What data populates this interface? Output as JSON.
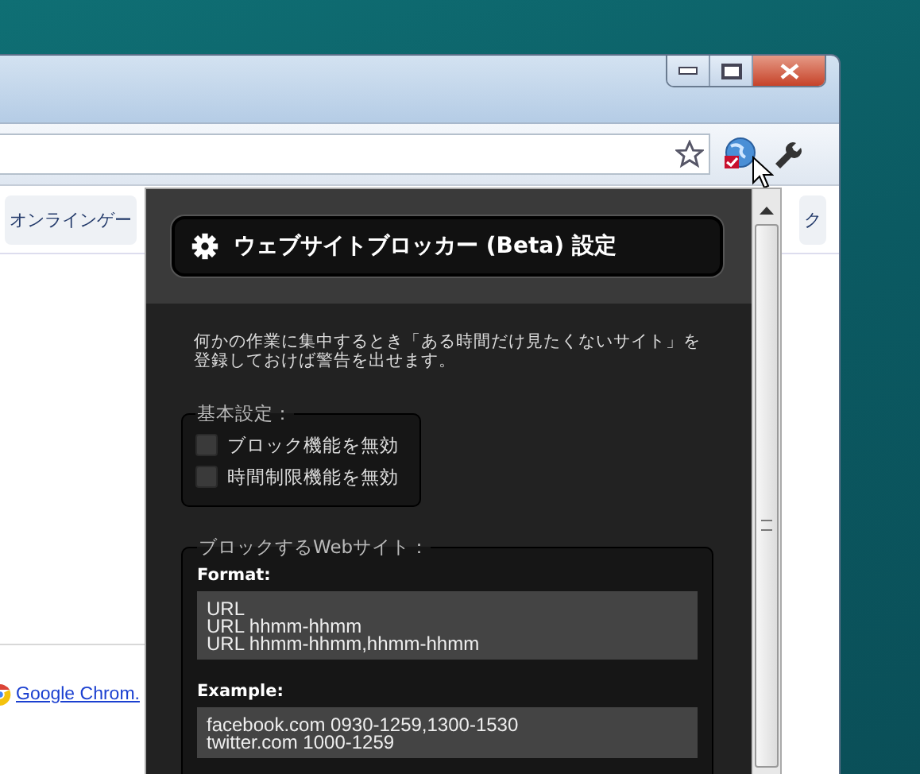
{
  "bookmarks": [
    {
      "label": "オンラインゲー"
    },
    {
      "label": "ク"
    }
  ],
  "page_link": "Google Chrom.",
  "popup": {
    "title": "ウェブサイトブロッカー (Beta) 設定",
    "description": [
      "何かの作業に集中するとき「ある時間だけ見たくないサイト」を",
      "登録しておけば警告を出せます。"
    ],
    "basic_settings": {
      "legend": "基本設定：",
      "options": [
        {
          "label": "ブロック機能を無効",
          "checked": false
        },
        {
          "label": "時間制限機能を無効",
          "checked": false
        }
      ]
    },
    "block_sites": {
      "legend": "ブロックするWebサイト：",
      "format_label": "Format:",
      "format_lines": [
        "URL",
        "URL hhmm-hhmm",
        "URL hhmm-hhmm,hhmm-hhmm"
      ],
      "example_label": "Example:",
      "example_lines": [
        "facebook.com 0930-1259,1300-1530",
        "twitter.com 1000-1259"
      ]
    }
  }
}
